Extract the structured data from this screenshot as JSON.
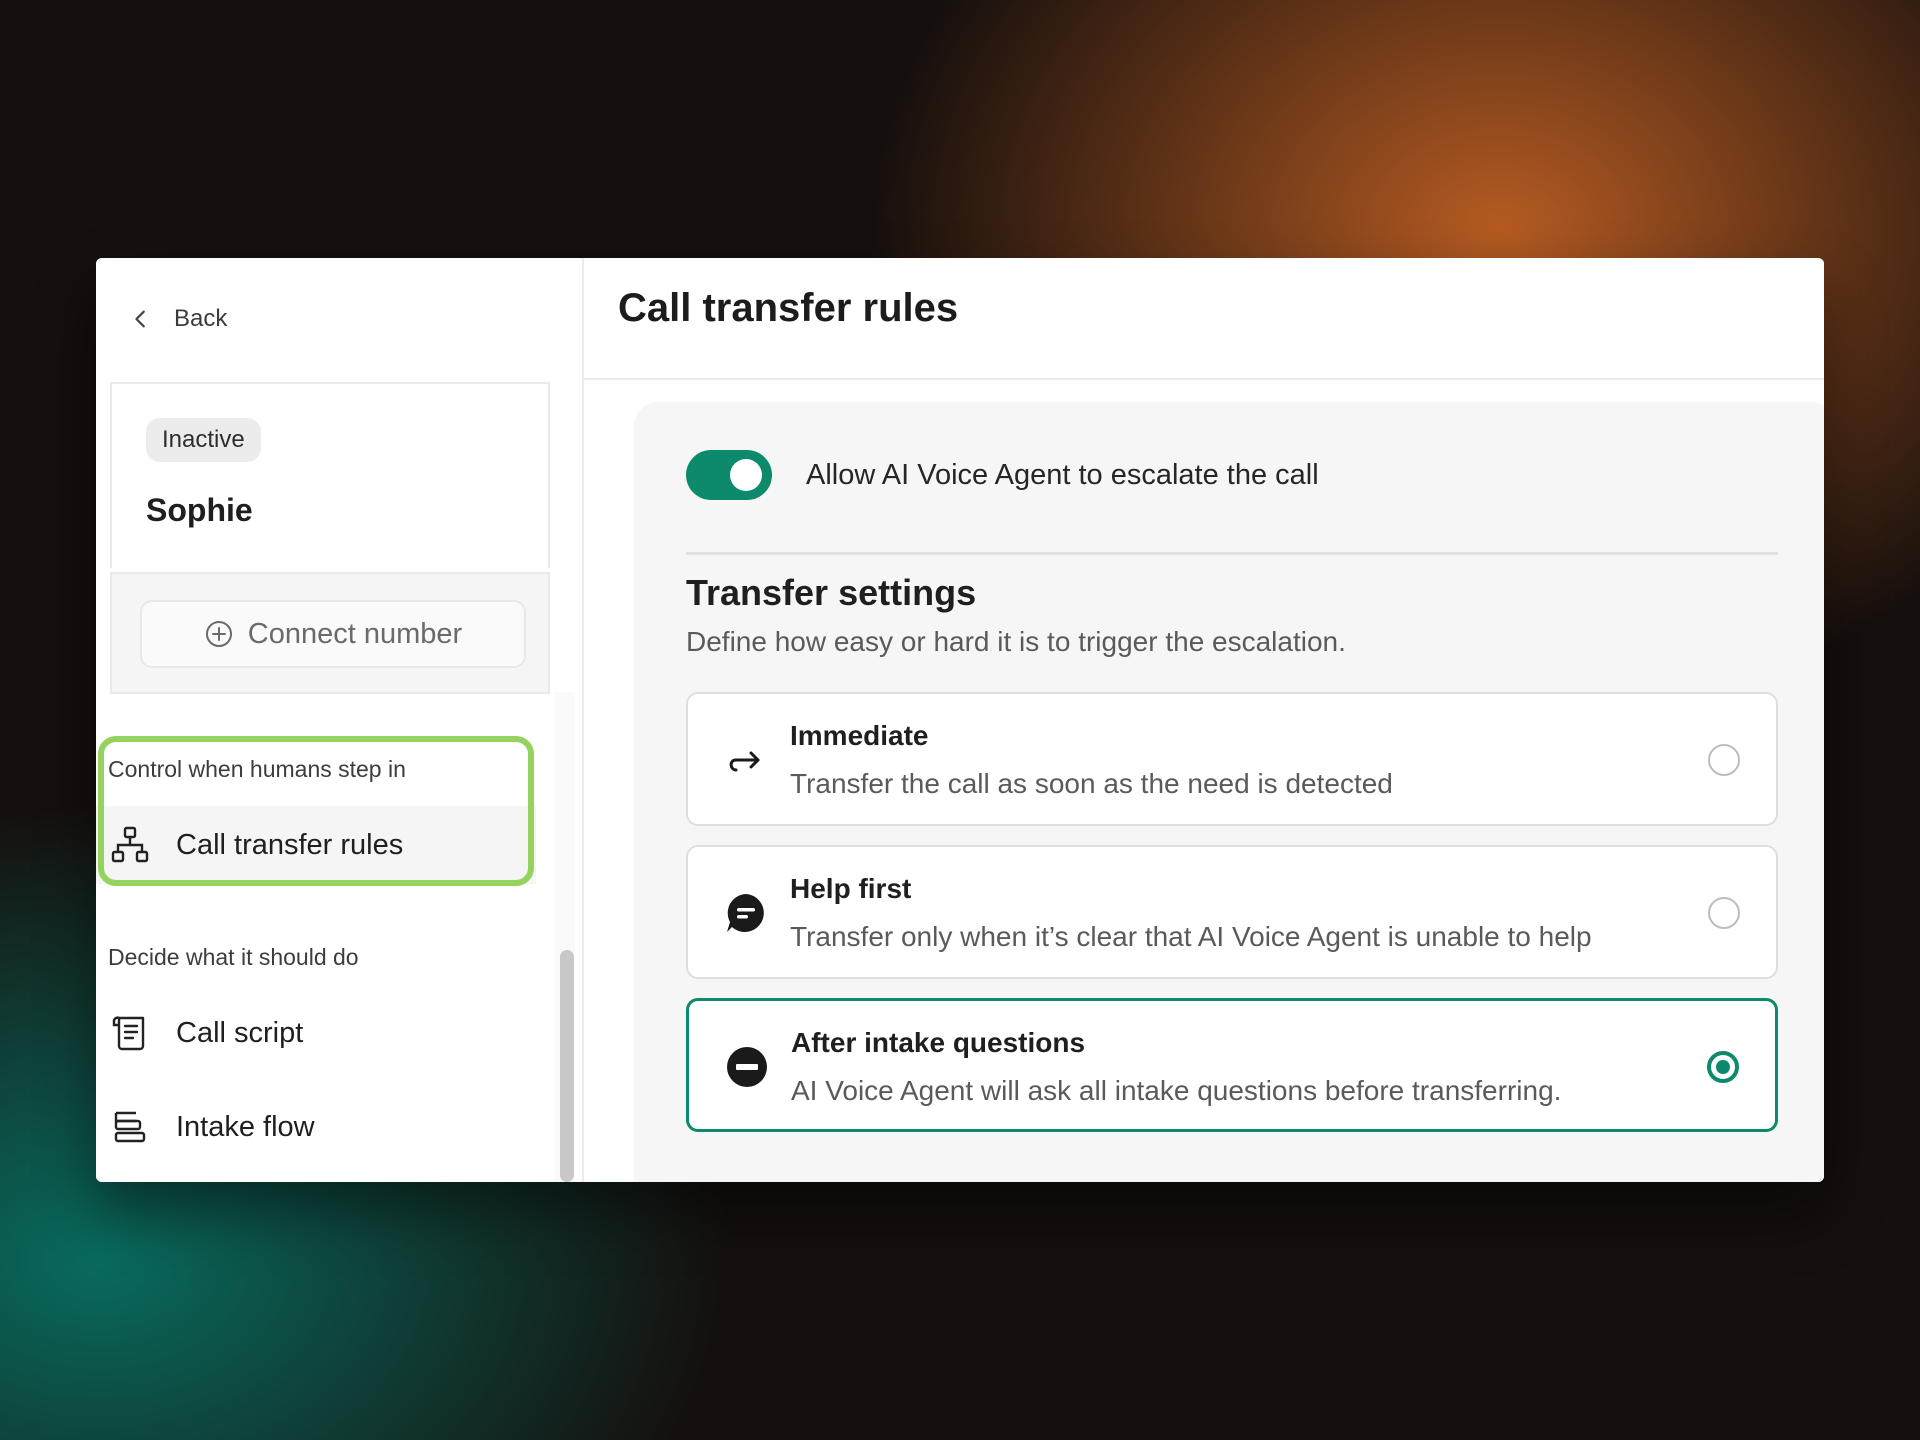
{
  "sidebar": {
    "back_label": "Back",
    "agent": {
      "status": "Inactive",
      "name": "Sophie"
    },
    "connect_number_label": "Connect number",
    "sections": [
      {
        "label": "Control when humans step in",
        "items": [
          {
            "label": "Call transfer rules",
            "icon": "hierarchy-icon",
            "active": true
          }
        ]
      },
      {
        "label": "Decide what it should do",
        "items": [
          {
            "label": "Call script",
            "icon": "script-icon"
          },
          {
            "label": "Intake flow",
            "icon": "flow-icon"
          }
        ]
      }
    ]
  },
  "main": {
    "title": "Call transfer rules",
    "escalation_toggle": {
      "label": "Allow AI Voice Agent to escalate the call",
      "on": true
    },
    "transfer_settings": {
      "title": "Transfer settings",
      "subtitle": "Define how easy or hard it is to trigger the escalation.",
      "options": [
        {
          "title": "Immediate",
          "description": "Transfer the call as soon as the need is detected",
          "icon": "redirect-arrow-icon",
          "selected": false
        },
        {
          "title": "Help first",
          "description": "Transfer only when it’s clear that AI Voice Agent is unable to help",
          "icon": "chat-bubble-icon",
          "selected": false
        },
        {
          "title": "After intake questions",
          "description": "AI Voice Agent will ask all intake questions before transferring.",
          "icon": "minus-circle-icon",
          "selected": true
        }
      ]
    }
  },
  "colors": {
    "accent": "#0c8a6b",
    "highlight": "#93d35e"
  }
}
